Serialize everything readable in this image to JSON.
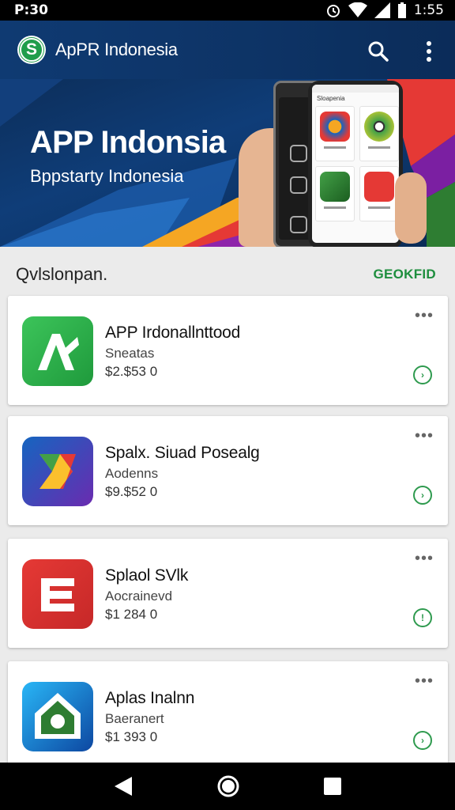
{
  "status_bar": {
    "time_left": "P:30",
    "time_right": "1:55"
  },
  "app_bar": {
    "logo_letter": "S",
    "title": "ApPR Indonesia",
    "search_icon": "search-icon",
    "more_icon": "more-vert-icon"
  },
  "banner": {
    "title": "APP Indonsia",
    "subtitle": "Bppstarty Indonesia",
    "phone_screen_title": "Sloapenia"
  },
  "section": {
    "title": "Qvlslonpan.",
    "action": "GEOKFID"
  },
  "apps": [
    {
      "name": "APP Irdonallnttood",
      "developer": "Sneatas",
      "price": "$2.$53 0",
      "icon": "android-style-icon",
      "colors": [
        "#3cc45a",
        "#1f9a3c"
      ]
    },
    {
      "name": "Spalx. Siuad Posealg",
      "developer": "Aodenns",
      "price": "$9.$52 0",
      "icon": "play-style-icon",
      "colors": [
        "#1565c0",
        "#6a2bb0"
      ]
    },
    {
      "name": "Splaol SVlk",
      "developer": "Aocrainevd",
      "price": "$1 284 0",
      "icon": "letter-e-icon",
      "colors": [
        "#e53935",
        "#c62828"
      ]
    },
    {
      "name": "Aplas Inalnn",
      "developer": "Baeranert",
      "price": "$1 393 0",
      "icon": "shield-house-icon",
      "colors": [
        "#1e88e5",
        "#0d47a1"
      ]
    }
  ],
  "nav": {
    "back": "back-icon",
    "home": "home-icon",
    "recents": "recents-icon"
  }
}
